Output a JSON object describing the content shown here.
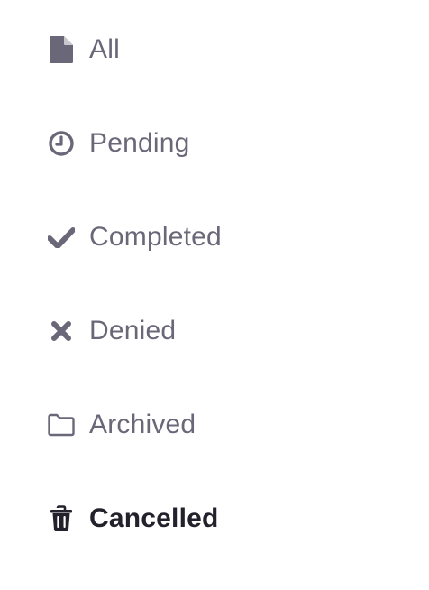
{
  "filters": {
    "items": [
      {
        "label": "All",
        "icon": "document-icon",
        "active": false
      },
      {
        "label": "Pending",
        "icon": "clock-icon",
        "active": false
      },
      {
        "label": "Completed",
        "icon": "checkmark-icon",
        "active": false
      },
      {
        "label": "Denied",
        "icon": "close-icon",
        "active": false
      },
      {
        "label": "Archived",
        "icon": "folder-icon",
        "active": false
      },
      {
        "label": "Cancelled",
        "icon": "trash-icon",
        "active": true
      }
    ]
  },
  "colors": {
    "inactive_text": "#6a6878",
    "active_text": "#23222c",
    "background": "#ffffff"
  }
}
